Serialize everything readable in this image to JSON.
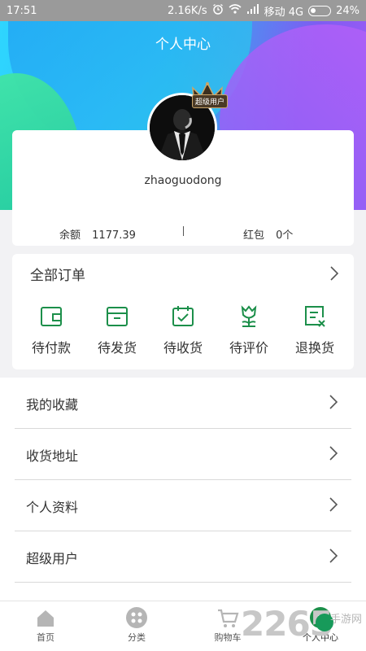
{
  "status_bar": {
    "time": "17:51",
    "speed": "2.16K/s",
    "carrier": "移动 4G",
    "battery": "24%"
  },
  "header": {
    "title": "个人中心"
  },
  "profile": {
    "username": "zhaoguodong",
    "vip_badge": "超级用户",
    "balance_label": "余额",
    "balance_value": "1177.39",
    "redpacket_label": "红包",
    "redpacket_value": "0个"
  },
  "orders": {
    "title": "全部订单",
    "items": [
      {
        "label": "待付款",
        "icon": "wallet-icon"
      },
      {
        "label": "待发货",
        "icon": "box-icon"
      },
      {
        "label": "待收货",
        "icon": "calendar-check-icon"
      },
      {
        "label": "待评价",
        "icon": "flower-icon"
      },
      {
        "label": "退换货",
        "icon": "return-doc-icon"
      }
    ]
  },
  "menu": {
    "items": [
      {
        "label": "我的收藏"
      },
      {
        "label": "收货地址"
      },
      {
        "label": "个人资料"
      },
      {
        "label": "超级用户"
      }
    ]
  },
  "tabbar": {
    "items": [
      {
        "label": "首页",
        "icon": "home-icon"
      },
      {
        "label": "分类",
        "icon": "grid-icon"
      },
      {
        "label": "购物车",
        "icon": "cart-icon"
      },
      {
        "label": "个人中心",
        "icon": "user-icon"
      }
    ]
  },
  "watermark": {
    "number": "2265",
    "text": "手游网"
  },
  "colors": {
    "accent": "#1c8f4a",
    "gradient_start": "#2fd6ff",
    "gradient_end": "#a15af5"
  }
}
